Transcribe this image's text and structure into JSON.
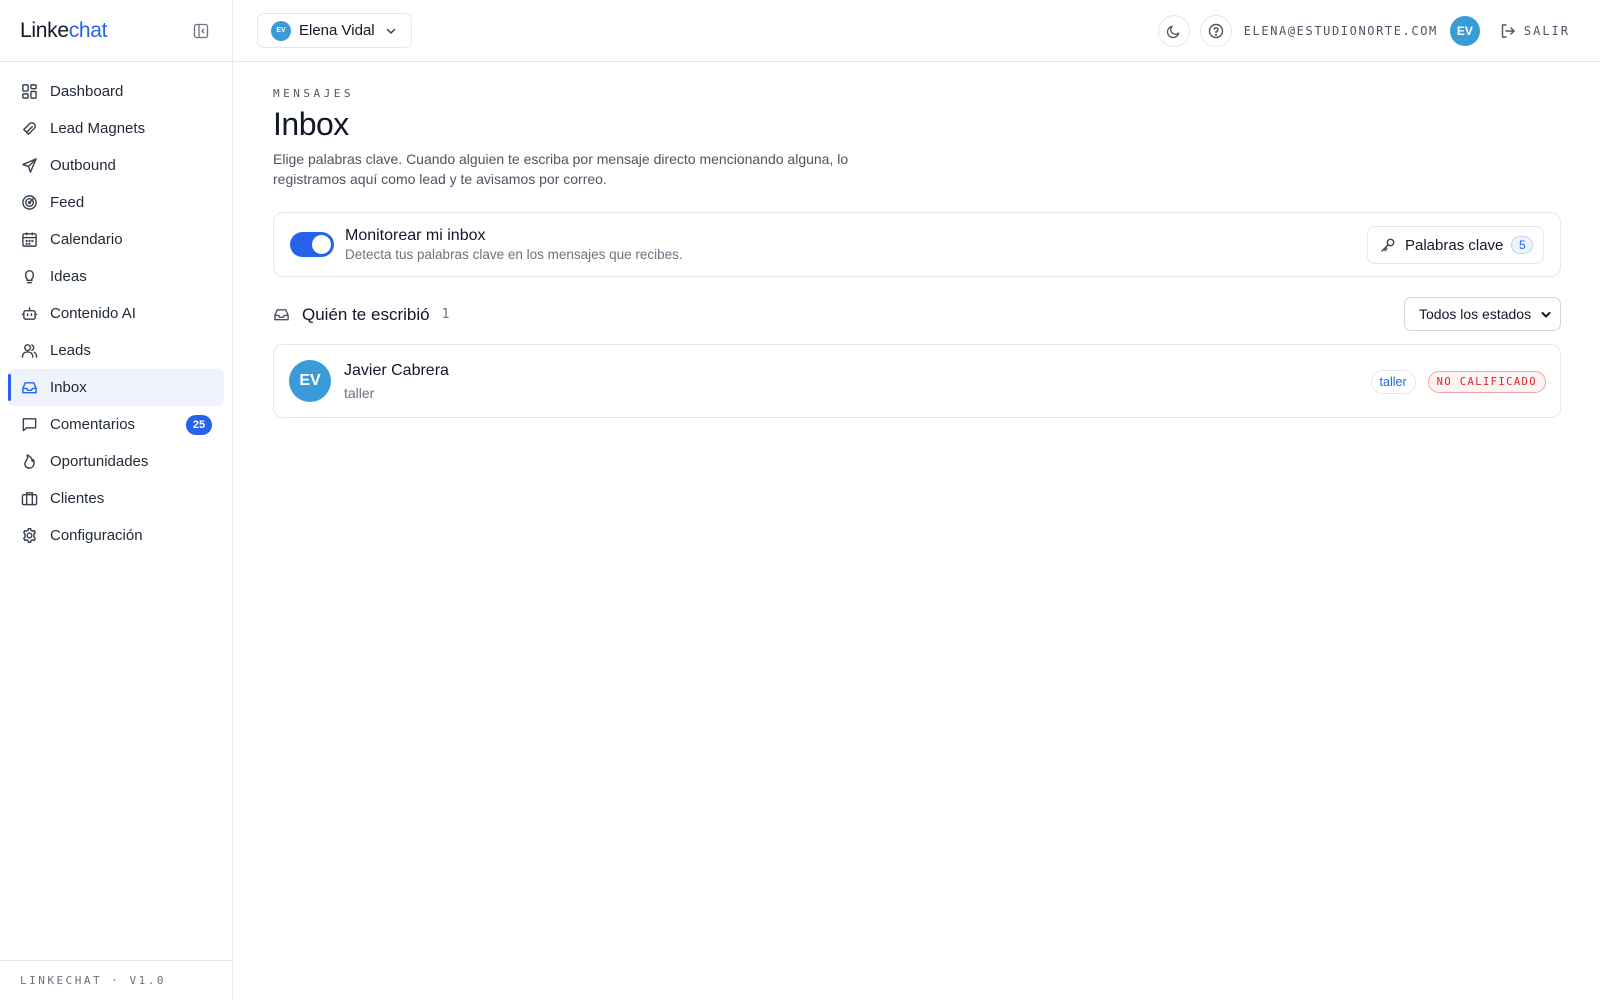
{
  "brand": {
    "name_part1": "Linke",
    "name_part2": "chat",
    "accent_color": "#2563eb"
  },
  "sidebar": {
    "collapse_icon": "sidebar-collapse-icon",
    "items": [
      {
        "id": "dashboard",
        "label": "Dashboard",
        "icon": "grid-icon"
      },
      {
        "id": "lead-magnets",
        "label": "Lead Magnets",
        "icon": "magnet-icon"
      },
      {
        "id": "outbound",
        "label": "Outbound",
        "icon": "send-icon"
      },
      {
        "id": "feed",
        "label": "Feed",
        "icon": "radar-icon"
      },
      {
        "id": "calendario",
        "label": "Calendario",
        "icon": "calendar-icon"
      },
      {
        "id": "ideas",
        "label": "Ideas",
        "icon": "lightbulb-icon"
      },
      {
        "id": "contenido-ai",
        "label": "Contenido AI",
        "icon": "bot-icon"
      },
      {
        "id": "leads",
        "label": "Leads",
        "icon": "users-icon"
      },
      {
        "id": "inbox",
        "label": "Inbox",
        "icon": "inbox-icon",
        "active": true
      },
      {
        "id": "comentarios",
        "label": "Comentarios",
        "icon": "message-square-icon",
        "badge": "25"
      },
      {
        "id": "oportunidades",
        "label": "Oportunidades",
        "icon": "flame-icon"
      },
      {
        "id": "clientes",
        "label": "Clientes",
        "icon": "briefcase-icon"
      },
      {
        "id": "configuracion",
        "label": "Configuración",
        "icon": "gear-icon"
      }
    ],
    "footer": "LINKECHAT · V1.0"
  },
  "topbar": {
    "account": {
      "initials": "EV",
      "name": "Elena Vidal"
    },
    "user_email": "ELENA@ESTUDIONORTE.COM",
    "user_initials": "EV",
    "logout_label": "SALIR"
  },
  "page": {
    "eyebrow": "MENSAJES",
    "title": "Inbox",
    "description": "Elige palabras clave. Cuando alguien te escriba por mensaje directo mencionando alguna, lo registramos aquí como lead y te avisamos por correo."
  },
  "monitor": {
    "enabled": true,
    "title": "Monitorear mi inbox",
    "subtitle": "Detecta tus palabras clave en los mensajes que recibes.",
    "keywords_button": "Palabras clave",
    "keywords_count": "5"
  },
  "senders": {
    "title": "Quién te escribió",
    "count": "1",
    "filter": {
      "selected": "Todos los estados"
    },
    "items": [
      {
        "initials": "EV",
        "name": "Javier Cabrera",
        "keyword": "taller",
        "keyword_tag": "taller",
        "status": "NO CALIFICADO"
      }
    ]
  }
}
